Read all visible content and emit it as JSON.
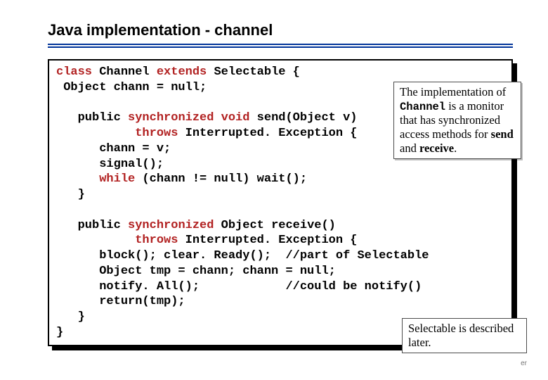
{
  "title": "Java implementation - channel",
  "code": {
    "l01a": "class",
    "l01b": " Channel ",
    "l01c": "extends",
    "l01d": " Selectable {",
    "l02": " Object chann = null;",
    "blank1": "",
    "l03a": "   public ",
    "l03b": "synchronized void",
    "l03c": " send(Object v)",
    "l04a": "           throws",
    "l04b": " Interrupted. Exception {",
    "l05": "      chann = v;",
    "l06": "      signal();",
    "l07a": "      while",
    "l07b": " (chann != null) wait();",
    "l08": "   }",
    "blank2": "",
    "l09a": "   public ",
    "l09b": "synchronized",
    "l09c": " Object receive()",
    "l10a": "           throws",
    "l10b": " Interrupted. Exception {",
    "l11": "      block(); clear. Ready();  //part of Selectable",
    "l12": "      Object tmp = chann; chann = null;",
    "l13": "      notify. All();            //could be notify()",
    "l14": "      return(tmp);",
    "l15": "   }",
    "l16": "}"
  },
  "note1": {
    "t1": "The implementation of ",
    "mono": "Channel",
    "t2": " is a monitor that has synchronized access methods for ",
    "b1": "send",
    "t3": " and ",
    "b2": "receive",
    "t4": "."
  },
  "note2": {
    "t1": "Selectable is described later."
  },
  "footer": "er"
}
